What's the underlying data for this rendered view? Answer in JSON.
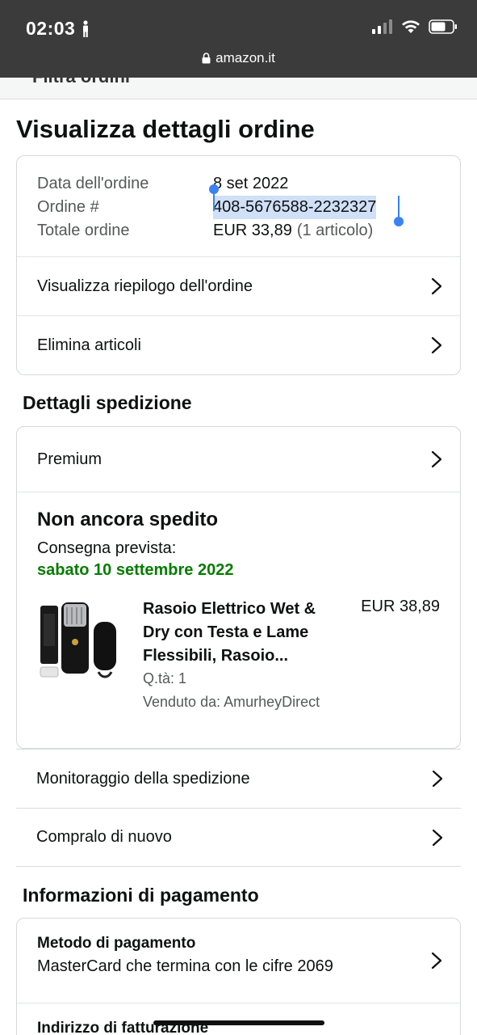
{
  "status_bar": {
    "time": "02:03",
    "url": "amazon.it"
  },
  "prev_header": "Filtra ordini",
  "page_title": "Visualizza dettagli ordine",
  "order_info": {
    "date_label": "Data dell'ordine",
    "date_value": "8 set 2022",
    "number_label": "Ordine #",
    "number_value": "408-5676588-2232327",
    "total_label": "Totale ordine",
    "total_value": "EUR 33,89",
    "total_items": "(1 articolo)"
  },
  "order_links": {
    "summary": "Visualizza riepilogo dell'ordine",
    "delete_items": "Elimina articoli"
  },
  "shipping": {
    "section_title": "Dettagli spedizione",
    "method": "Premium",
    "status": "Non ancora spedito",
    "delivery_label": "Consegna prevista:",
    "delivery_date": "sabato 10 settembre 2022",
    "product": {
      "title": "Rasoio Elettrico Wet & Dry con Testa e Lame Flessibili, Rasoio...",
      "price": "EUR 38,89",
      "quantity": "Q.tà: 1",
      "seller": "Venduto da: AmurheyDirect"
    },
    "tracking_link": "Monitoraggio della spedizione",
    "buy_again_link": "Compralo di nuovo"
  },
  "payment": {
    "section_title": "Informazioni di pagamento",
    "method_label": "Metodo di pagamento",
    "method_value": "MasterCard che termina con le cifre 2069",
    "billing_label": "Indirizzo di fatturazione"
  },
  "colors": {
    "accent_green": "#067d00",
    "selection": "#cfe0f7",
    "handle_blue": "#3b82f6"
  },
  "icons": [
    "person-icon",
    "signal-icon",
    "wifi-icon",
    "battery-icon",
    "lock-icon",
    "chevron-right-icon"
  ]
}
